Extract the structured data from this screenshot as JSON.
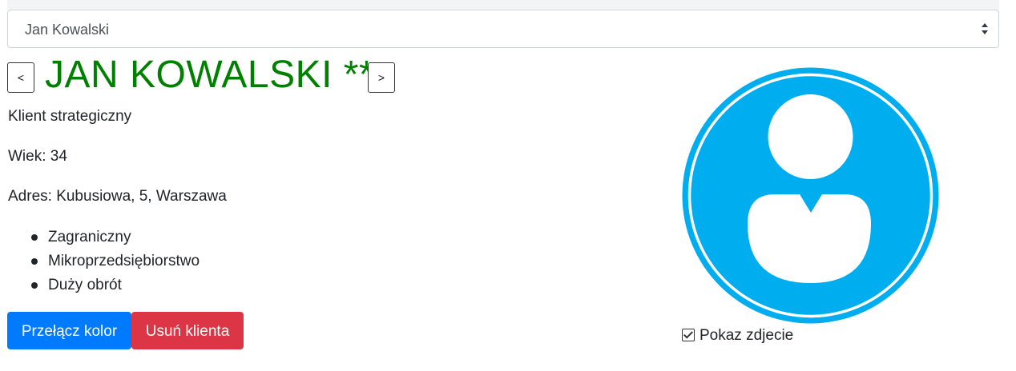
{
  "select": {
    "value": "Jan Kowalski"
  },
  "nav": {
    "prev_label": "<",
    "next_label": ">"
  },
  "client": {
    "name": "JAN KOWALSKI **",
    "name_color": "#008000",
    "type": "Klient strategiczny",
    "age_line": "Wiek: 34",
    "address_line": "Adres: Kubusiowa, 5, Warszawa",
    "tags": [
      "Zagraniczny",
      "Mikroprzedsiębiorstwo",
      "Duży obrót"
    ]
  },
  "buttons": {
    "toggle_color": "Przełącz kolor",
    "delete_client": "Usuń klienta"
  },
  "photo": {
    "icon": "user-avatar-icon",
    "color": "#00aeef",
    "show_label": "Pokaz zdjecie",
    "show_checked": true
  },
  "colors": {
    "primary": "#007bff",
    "danger": "#dc3545"
  }
}
